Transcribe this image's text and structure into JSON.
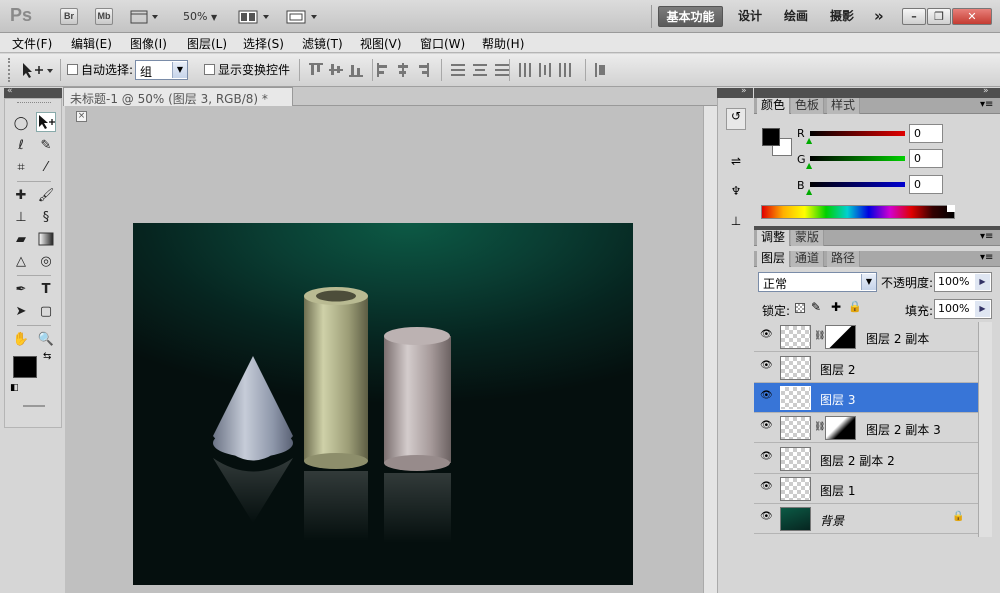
{
  "app": {
    "logo": "Ps",
    "bridge_btn": "Br",
    "minibridge_btn": "Mb",
    "zoom_value": "50%",
    "workspaces": [
      "基本功能",
      "设计",
      "绘画",
      "摄影"
    ],
    "more_glyph": "»"
  },
  "menubar": [
    "文件(F)",
    "编辑(E)",
    "图像(I)",
    "图层(L)",
    "选择(S)",
    "滤镜(T)",
    "视图(V)",
    "窗口(W)",
    "帮助(H)"
  ],
  "options": {
    "auto_select_label": "自动选择:",
    "auto_select_value": "组",
    "show_transform_label": "显示变换控件"
  },
  "document": {
    "tab_title": "未标题-1 @ 50% (图层 3, RGB/8) *",
    "close_glyph": "×"
  },
  "color_panel": {
    "tabs": [
      "颜色",
      "色板",
      "样式"
    ],
    "r_label": "R",
    "g_label": "G",
    "b_label": "B",
    "r_value": "0",
    "g_value": "0",
    "b_value": "0"
  },
  "adjust_panel": {
    "tabs": [
      "调整",
      "蒙版"
    ]
  },
  "layers_panel": {
    "tabs": [
      "图层",
      "通道",
      "路径"
    ],
    "blend_mode": "正常",
    "opacity_label": "不透明度:",
    "opacity_value": "100%",
    "lock_label": "锁定:",
    "fill_label": "填充:",
    "fill_value": "100%",
    "layers": [
      {
        "name": "图层 2 副本",
        "mask": true
      },
      {
        "name": "图层 2",
        "mask": false
      },
      {
        "name": "图层 3",
        "mask": false,
        "selected": true
      },
      {
        "name": "图层 2 副本 3",
        "mask": true
      },
      {
        "name": "图层 2 副本 2",
        "mask": false
      },
      {
        "name": "图层 1",
        "mask": false
      },
      {
        "name": "背景",
        "mask": false,
        "locked": true
      }
    ]
  },
  "colors": {
    "selection": "#3875d7",
    "canvas_green": "#0a4a3c"
  }
}
